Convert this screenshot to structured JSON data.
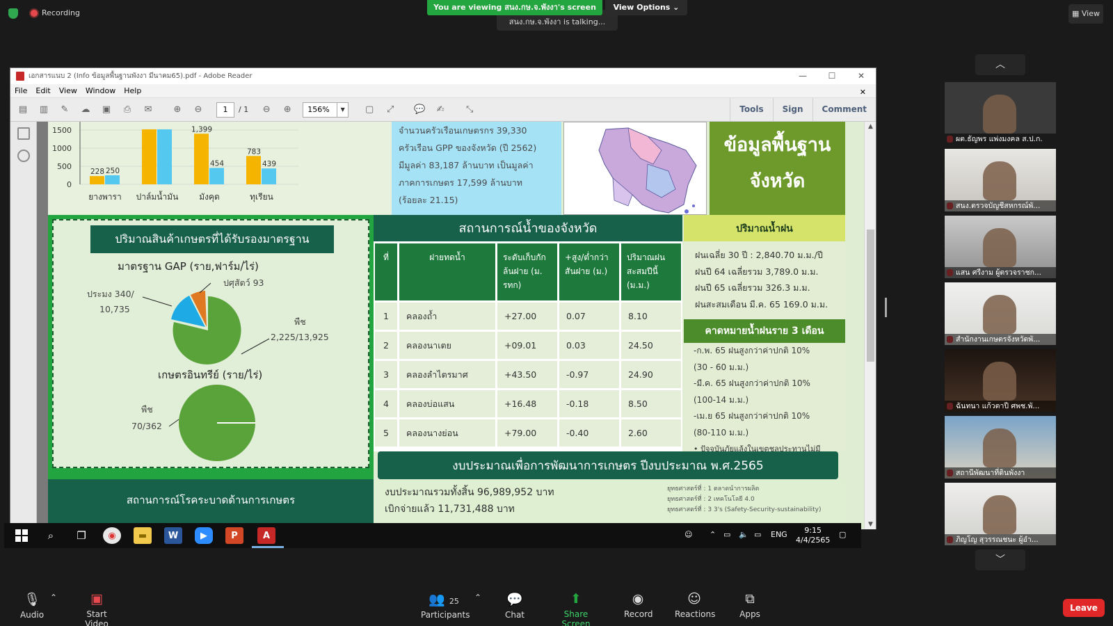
{
  "zoom_top": {
    "recording": "Recording",
    "viewing": "You are viewing สนง.กษ.จ.พังงา's screen",
    "talking": "สนง.กษ.จ.พังงา is talking...",
    "view_options": "View Options",
    "view": "View"
  },
  "adobe": {
    "title": "เอกสารแนบ 2 (Info ข้อมูลพื้นฐานพังงา มีนาคม65).pdf - Adobe Reader",
    "menu": [
      "File",
      "Edit",
      "View",
      "Window",
      "Help"
    ],
    "page_current": "1",
    "page_total": "/ 1",
    "zoom": "156%",
    "right_tabs": [
      "Tools",
      "Sign",
      "Comment"
    ]
  },
  "doc": {
    "household_lines": [
      "จำนวนครัวเรือนเกษตรกร 39,330",
      "ครัวเรือน GPP ของจังหวัด (ปี 2562)",
      "มีมูลค่า 83,187 ล้านบาท เป็นมูลค่า",
      "ภาคการเกษตร 17,599 ล้านบาท",
      "(ร้อยละ 21.15)"
    ],
    "info_title_1": "ข้อมูลพื้นฐาน",
    "info_title_2": "จังหวัด",
    "gap_title": "ปริมาณสินค้าเกษตรที่ได้รับรองมาตรฐาน",
    "gap_sub": "มาตรฐาน GAP (ราย,ฟาร์ม/ไร่)",
    "gap_labels": {
      "fishery": "ประมง 340/",
      "fishery2": "10,735",
      "livestock": "ปศุสัตว์ 93",
      "plant": "พืช",
      "plant2": "2,225/13,925"
    },
    "organic_sub": "เกษตรอินทรีย์ (ราย/ไร่)",
    "organic_labels": {
      "plant": "พืช",
      "plant2": "70/362"
    },
    "disease_title": "สถานการณ์โรคระบาดด้านการเกษตร",
    "water_title": "สถานการณ์น้ำของจังหวัด",
    "water_headers": [
      "ที่",
      "ฝายทดน้ำ",
      "ระดับเก็บกักล้นฝาย (ม. รทก)",
      "+สูง/ต่ำกว่าสันฝาย (ม.)",
      "ปริมาณฝนสะสมปีนี้ (ม.ม.)"
    ],
    "water_rows": [
      {
        "no": "1",
        "name": "คลองถ้ำ",
        "level": "+27.00",
        "diff": "0.07",
        "rain": "8.10"
      },
      {
        "no": "2",
        "name": "คลองนาเตย",
        "level": "+09.01",
        "diff": "0.03",
        "rain": "24.50"
      },
      {
        "no": "3",
        "name": "คลองลำไตรมาศ",
        "level": "+43.50",
        "diff": "-0.97",
        "rain": "24.90"
      },
      {
        "no": "4",
        "name": "คลองบ่อแสน",
        "level": "+16.48",
        "diff": "-0.18",
        "rain": "8.50"
      },
      {
        "no": "5",
        "name": "คลองนางย่อน",
        "level": "+79.00",
        "diff": "-0.40",
        "rain": "2.60"
      }
    ],
    "rain_title": "ปริมาณน้ำฝน",
    "rain_lines": [
      "ฝนเฉลี่ย 30 ปี : 2,840.70 ม.ม./ปี",
      "ฝนปี 64 เฉลี่ยรวม 3,789.0 ม.ม.",
      "ฝนปี 65 เฉลี่ยรวม 326.3 ม.ม.",
      "ฝนสะสมเดือน มี.ค. 65 169.0 ม.ม."
    ],
    "forecast_title": "คาดหมายน้ำฝนราย 3 เดือน",
    "forecast_lines": [
      "-ก.พ. 65 ฝนสูงกว่าค่าปกติ 10%",
      "(30 - 60 ม.ม.)",
      "-มี.ค. 65 ฝนสูงกว่าค่าปกติ 10%",
      "(100-14 ม.ม.)",
      "-เม.ย 65 ฝนสูงกว่าค่าปกติ 10%",
      "(80-110 ม.ม.)",
      "• ปัจจุบันภัยแล้งในเขตชลประทานไม่มี"
    ],
    "budget_title": "งบประมาณเพื่อการพัฒนาการเกษตร ปีงบประมาณ พ.ศ.2565",
    "budget_total": "งบประมาณรวมทั้งสิ้น 96,989,952 บาท",
    "budget_spent": "เบิกจ่ายแล้ว       11,731,488 บาท",
    "strategies": [
      "ยุทธศาสตร์ที่ : 1 ตลาดนำการผลิต",
      "ยุทธศาสตร์ที่ : 2 เทคโนโลยี 4.0",
      "ยุทธศาสตร์ที่ : 3 3's (Safety-Security-sustainability)"
    ]
  },
  "chart_data": {
    "type": "bar",
    "categories": [
      "ยางพารา",
      "ปาล์มน้ำมัน",
      "มังคุด",
      "ทุเรียน"
    ],
    "series": [
      {
        "values": [
          228,
          1520,
          1399,
          783
        ],
        "color": "#f4b400"
      },
      {
        "values": [
          250,
          1520,
          454,
          439
        ],
        "color": "#55c8f0"
      }
    ],
    "data_labels": [
      [
        "228",
        "",
        "1,399",
        "783"
      ],
      [
        "250",
        "",
        "454",
        "439"
      ]
    ],
    "ylim": [
      0,
      1500
    ],
    "yticks": [
      "0",
      "500",
      "1000",
      "1500"
    ]
  },
  "taskbar": {
    "lang": "ENG",
    "time": "9:15",
    "date": "4/4/2565"
  },
  "participants": [
    {
      "name": "ผต.ธัญพร แพ่งมงคล ส.ป.ก."
    },
    {
      "name": "สนง.ตรวจบัญชีสหกรณ์พั..."
    },
    {
      "name": "แสน ศรีงาม ผู้ตรวจราชก..."
    },
    {
      "name": "สำนักงานเกษตรจังหวัดพั..."
    },
    {
      "name": "ฉันทนา แก้วตาปี ศพช.พั..."
    },
    {
      "name": "สถานีพัฒนาที่ดินพังงา"
    },
    {
      "name": "ภิญโญ สุวรรณชนะ ผู้อำ..."
    }
  ],
  "controls": {
    "audio": "Audio",
    "video": "Start Video",
    "participants": "Participants",
    "participants_count": "25",
    "chat": "Chat",
    "share": "Share Screen",
    "record": "Record",
    "reactions": "Reactions",
    "apps": "Apps",
    "leave": "Leave"
  },
  "colors": {
    "zoom_green": "#23a53f",
    "doc_green": "#17604a",
    "leave_red": "#e02828"
  }
}
